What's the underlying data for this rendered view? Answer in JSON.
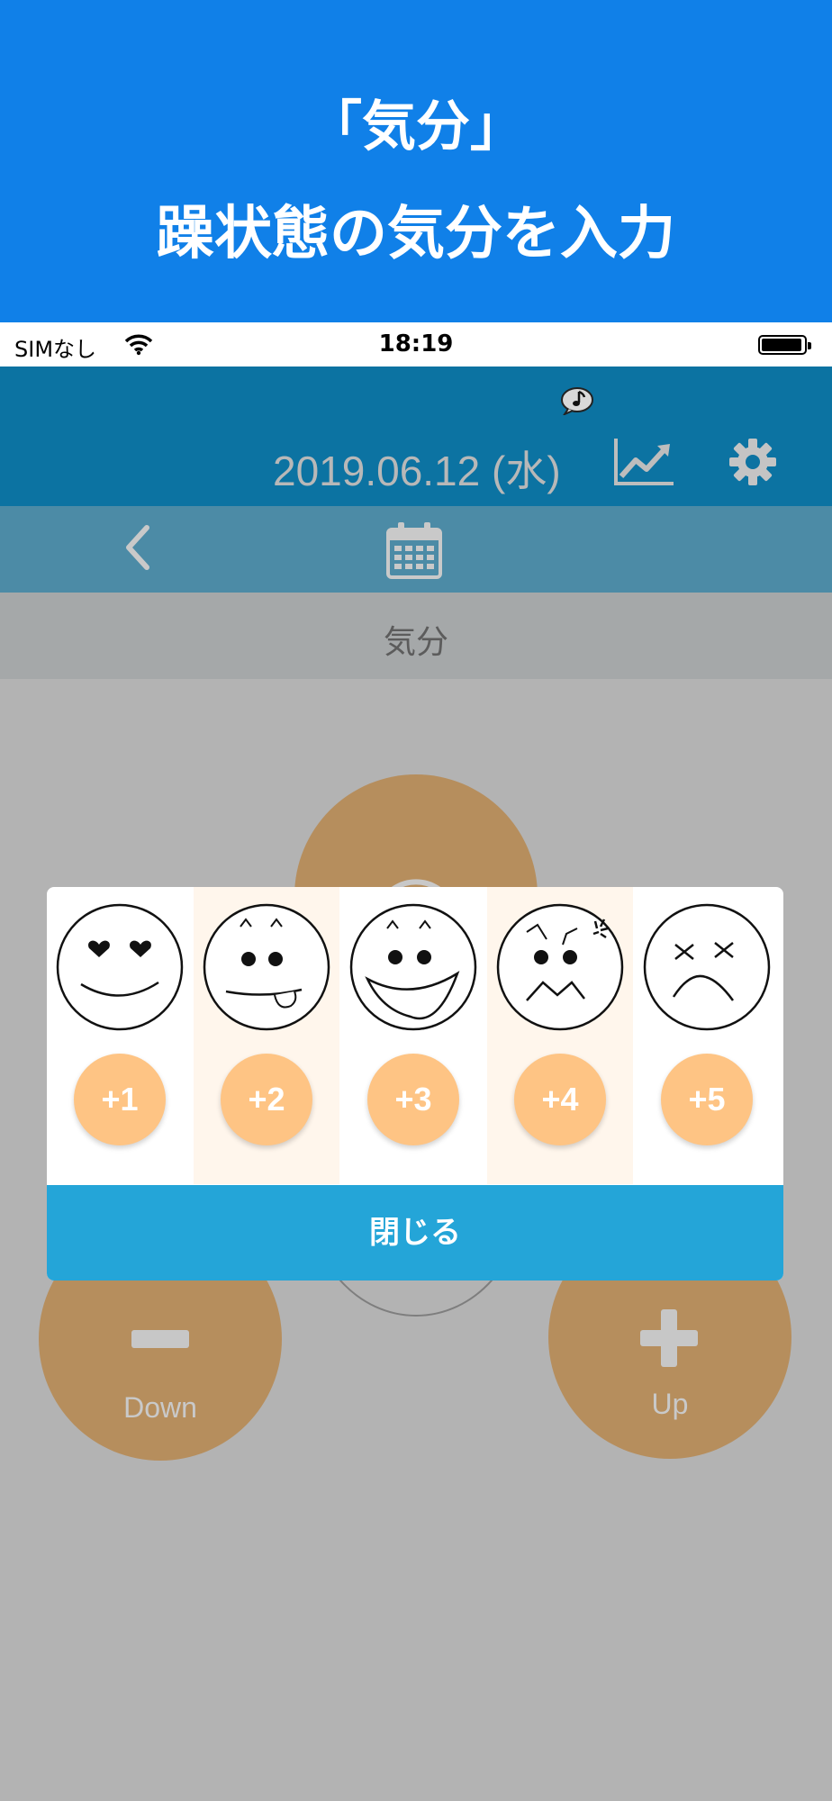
{
  "banner": {
    "line1": "「気分」",
    "line2": "躁状態の気分を入力"
  },
  "statusbar": {
    "carrier": "SIMなし",
    "time": "18:19"
  },
  "header": {
    "date": "2019.06.12 (水)"
  },
  "section": {
    "title": "気分"
  },
  "controls": {
    "down_label": "Down",
    "up_label": "Up"
  },
  "popup": {
    "options": [
      {
        "label": "+1",
        "face": "heart-eyes-face-icon"
      },
      {
        "label": "+2",
        "face": "tongue-out-face-icon"
      },
      {
        "label": "+3",
        "face": "grinning-face-icon"
      },
      {
        "label": "+4",
        "face": "angry-face-icon"
      },
      {
        "label": "+5",
        "face": "dizzy-face-icon"
      }
    ],
    "close_label": "閉じる"
  },
  "colors": {
    "banner": "#1080e8",
    "header": "#0c73a2",
    "accent_button": "#fec484",
    "close_button": "#24a5d8"
  }
}
